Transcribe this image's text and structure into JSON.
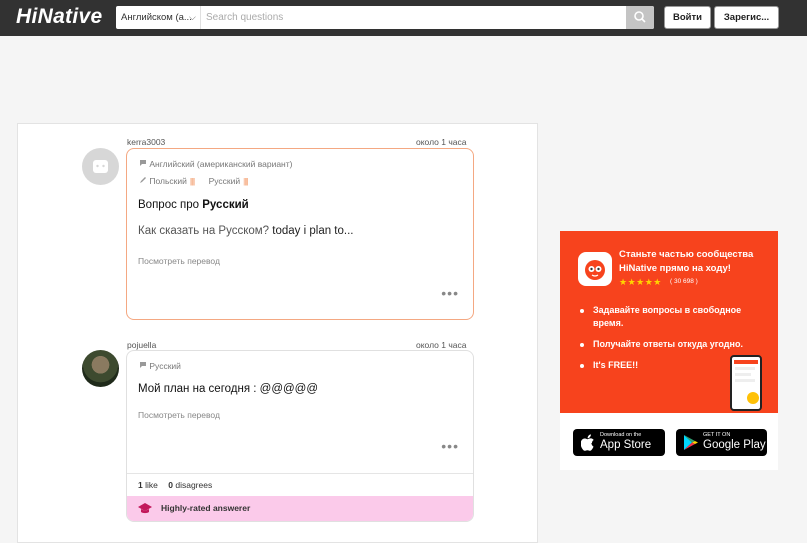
{
  "header": {
    "logo": "HiNative",
    "language_select": "Английском (а...",
    "search_placeholder": "Search questions",
    "login_label": "Войти",
    "signup_label": "Зарегис..."
  },
  "questions": [
    {
      "username": "kerra3003",
      "time": "около 1 часа",
      "native_lang": "Английский (американский вариант)",
      "learning": [
        {
          "lang": "Польский",
          "level": "||||"
        },
        {
          "lang": "Русский",
          "level": "||||"
        }
      ],
      "title_prefix": "Вопрос про",
      "title_lang": "Русский",
      "body": "Как сказать на Русском?",
      "body_en": "today i plan to...",
      "translate_label": "Посмотреть перевод",
      "more": "•••"
    },
    {
      "username": "pojuella",
      "time": "около 1 часа",
      "native_lang": "Русский",
      "body": "Мой план на сегодня : @@@@@",
      "translate_label": "Посмотреть перевод",
      "more": "•••",
      "like_count": "1",
      "like_label": "like",
      "disagree_count": "0",
      "disagree_label": "disagrees",
      "badge": "Highly-rated answerer"
    }
  ],
  "promo": {
    "title": "Станьте частью сообщества HiNative прямо на ходу!",
    "stars": "★★★★★",
    "rating_count": "( 30 698 )",
    "bullets": [
      "Задавайте вопросы в свободное время.",
      "Получайте ответы откуда угодно.",
      "It's FREE!!"
    ],
    "accent": "#f7431d"
  },
  "stores": {
    "apple_small": "Download on the",
    "apple_big": "App Store",
    "google_small": "GET IT ON",
    "google_big": "Google Play"
  }
}
